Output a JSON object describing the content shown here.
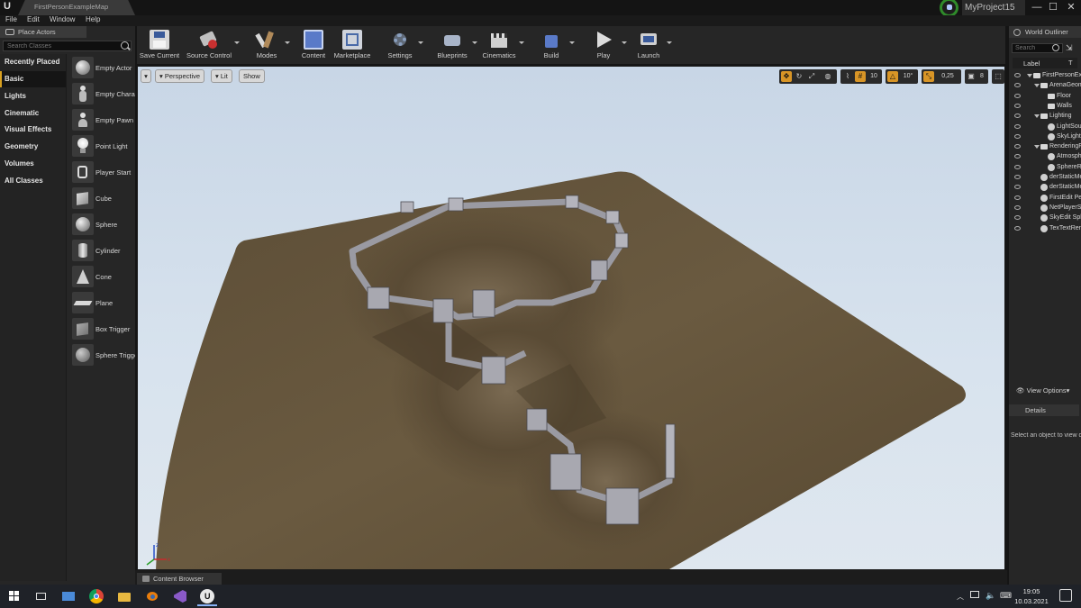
{
  "window": {
    "logo": "U",
    "doc_tab": "FirstPersonExampleMap",
    "project_name": "MyProject15",
    "controls": {
      "minimize": "—",
      "maximize": "☐",
      "close": "✕"
    }
  },
  "menu": [
    "File",
    "Edit",
    "Window",
    "Help"
  ],
  "place_actors": {
    "tab_label": "Place Actors",
    "search_placeholder": "Search Classes",
    "categories": [
      "Recently Placed",
      "Basic",
      "Lights",
      "Cinematic",
      "Visual Effects",
      "Geometry",
      "Volumes",
      "All Classes"
    ],
    "active_category": "Basic",
    "actors": [
      {
        "name": "Empty Actor",
        "icon": "sphere-icon"
      },
      {
        "name": "Empty Character",
        "icon": "character-icon"
      },
      {
        "name": "Empty Pawn",
        "icon": "pawn-icon"
      },
      {
        "name": "Point Light",
        "icon": "bulb-icon"
      },
      {
        "name": "Player Start",
        "icon": "player-start-icon"
      },
      {
        "name": "Cube",
        "icon": "cube-icon"
      },
      {
        "name": "Sphere",
        "icon": "sphere-icon"
      },
      {
        "name": "Cylinder",
        "icon": "cylinder-icon"
      },
      {
        "name": "Cone",
        "icon": "cone-icon"
      },
      {
        "name": "Plane",
        "icon": "plane-icon"
      },
      {
        "name": "Box Trigger",
        "icon": "box-trigger-icon"
      },
      {
        "name": "Sphere Trigger",
        "icon": "sphere-trigger-icon"
      }
    ]
  },
  "toolbar": {
    "buttons": [
      {
        "label": "Save Current",
        "icon": "save-icon"
      },
      {
        "label": "Source Control",
        "icon": "source-control-icon"
      },
      {
        "label": "Modes",
        "icon": "modes-icon"
      },
      {
        "label": "Content",
        "icon": "content-icon"
      },
      {
        "label": "Marketplace",
        "icon": "marketplace-icon"
      },
      {
        "label": "Settings",
        "icon": "settings-icon"
      },
      {
        "label": "Blueprints",
        "icon": "blueprints-icon"
      },
      {
        "label": "Cinematics",
        "icon": "cinematics-icon"
      },
      {
        "label": "Build",
        "icon": "build-icon"
      },
      {
        "label": "Play",
        "icon": "play-icon"
      },
      {
        "label": "Launch",
        "icon": "launch-icon"
      }
    ]
  },
  "viewport": {
    "perspective_label": "Perspective",
    "lit_label": "Lit",
    "show_label": "Show",
    "grid_snap": "10",
    "rotation_snap": "10°",
    "scale_snap": "0,25",
    "camera_speed": "8",
    "accent_color": "#d89526"
  },
  "content_browser": {
    "tab_label": "Content Browser"
  },
  "world_outliner": {
    "tab_label": "World Outliner",
    "search_placeholder": "Search",
    "column_label": "Label",
    "column_type": "T",
    "rows": [
      {
        "text": "FirstPersonExampleMap",
        "indent": 0,
        "kind": "world"
      },
      {
        "text": "ArenaGeometry",
        "indent": 1,
        "kind": "folder"
      },
      {
        "text": "Floor",
        "indent": 2,
        "kind": "folder"
      },
      {
        "text": "Walls",
        "indent": 2,
        "kind": "folder"
      },
      {
        "text": "Lighting",
        "indent": 1,
        "kind": "folder"
      },
      {
        "text": "LightSource",
        "indent": 2,
        "kind": "actor"
      },
      {
        "text": "SkyLight",
        "indent": 2,
        "kind": "actor"
      },
      {
        "text": "RenderingFX",
        "indent": 1,
        "kind": "folder"
      },
      {
        "text": "AtmosphericFog",
        "indent": 2,
        "kind": "actor"
      },
      {
        "text": "SphereReflectionCapture",
        "indent": 2,
        "kind": "actor"
      },
      {
        "text": "derStaticMesh",
        "indent": 1,
        "kind": "actor"
      },
      {
        "text": "derStaticMesh",
        "indent": 1,
        "kind": "actor"
      },
      {
        "text": "FirstEdit Person",
        "indent": 1,
        "kind": "actor"
      },
      {
        "text": "NetPlayerStart",
        "indent": 1,
        "kind": "actor"
      },
      {
        "text": "SkyEdit Sphere",
        "indent": 1,
        "kind": "actor"
      },
      {
        "text": "TexTextRender",
        "indent": 1,
        "kind": "actor"
      }
    ],
    "view_options": "View Options"
  },
  "details": {
    "tab_label": "Details",
    "message": "Select an object to view details."
  },
  "taskbar": {
    "icons": [
      "windows-start-icon",
      "task-view-icon",
      "explorer-shortcut-icon",
      "chrome-icon",
      "file-explorer-icon",
      "blender-icon",
      "visual-studio-icon",
      "unreal-engine-icon"
    ],
    "time": "19:05",
    "date": "10.03.2021"
  }
}
